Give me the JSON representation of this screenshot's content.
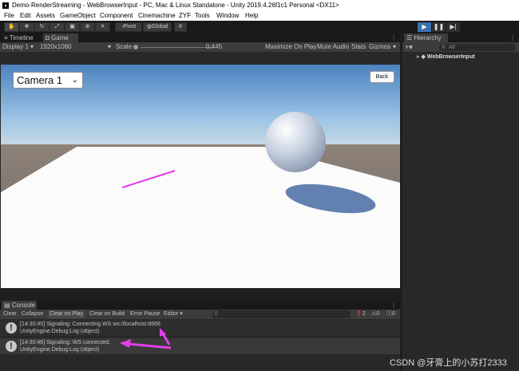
{
  "window": {
    "title": "Demo-RenderStreaming - WebBrowserInput - PC, Mac & Linux Standalone - Unity 2019.4.26f1c1 Personal <DX11>"
  },
  "menu": [
    "File",
    "Edit",
    "Assets",
    "GameObject",
    "Component",
    "Cinemachine",
    "ZYF",
    "Tools",
    "Window",
    "Help"
  ],
  "toolbar": {
    "pivot_label": "Pivot",
    "global_label": "Global"
  },
  "game_panel": {
    "tabs": [
      "Timeline",
      "Game"
    ],
    "display": "Display 1",
    "resolution": "1920x1080",
    "scale_label": "Scale",
    "scale_value": "0.445",
    "maximize": "Maximize On Play",
    "mute": "Mute Audio",
    "stats": "Stats",
    "gizmos": "Gizmos"
  },
  "scene": {
    "camera_select": "Camera 1",
    "back_button": "Back"
  },
  "hierarchy": {
    "tab": "Hierarchy",
    "search_placeholder": "All",
    "item": "WebBrowserInput"
  },
  "console": {
    "tab": "Console",
    "buttons": {
      "clear": "Clear",
      "collapse": "Collapse",
      "clear_on_play": "Clear on Play",
      "clear_on_build": "Clear on Build",
      "error_pause": "Error Pause",
      "editor": "Editor"
    },
    "counts": {
      "info": "2",
      "warning": "0",
      "error": "0"
    },
    "logs": [
      {
        "line1": "[14:30:45] Signaling: Connecting WS ws://localhost:8666",
        "line2": "UnityEngine.Debug:Log (object)"
      },
      {
        "line1": "[14:30:46] Signaling: WS connected.",
        "line2": "UnityEngine.Debug:Log (object)"
      }
    ]
  },
  "watermark": "CSDN @牙膏上的小苏打2333",
  "colors": {
    "play_active": "#3a72b0",
    "arrow_annotation": "#e040e8"
  }
}
